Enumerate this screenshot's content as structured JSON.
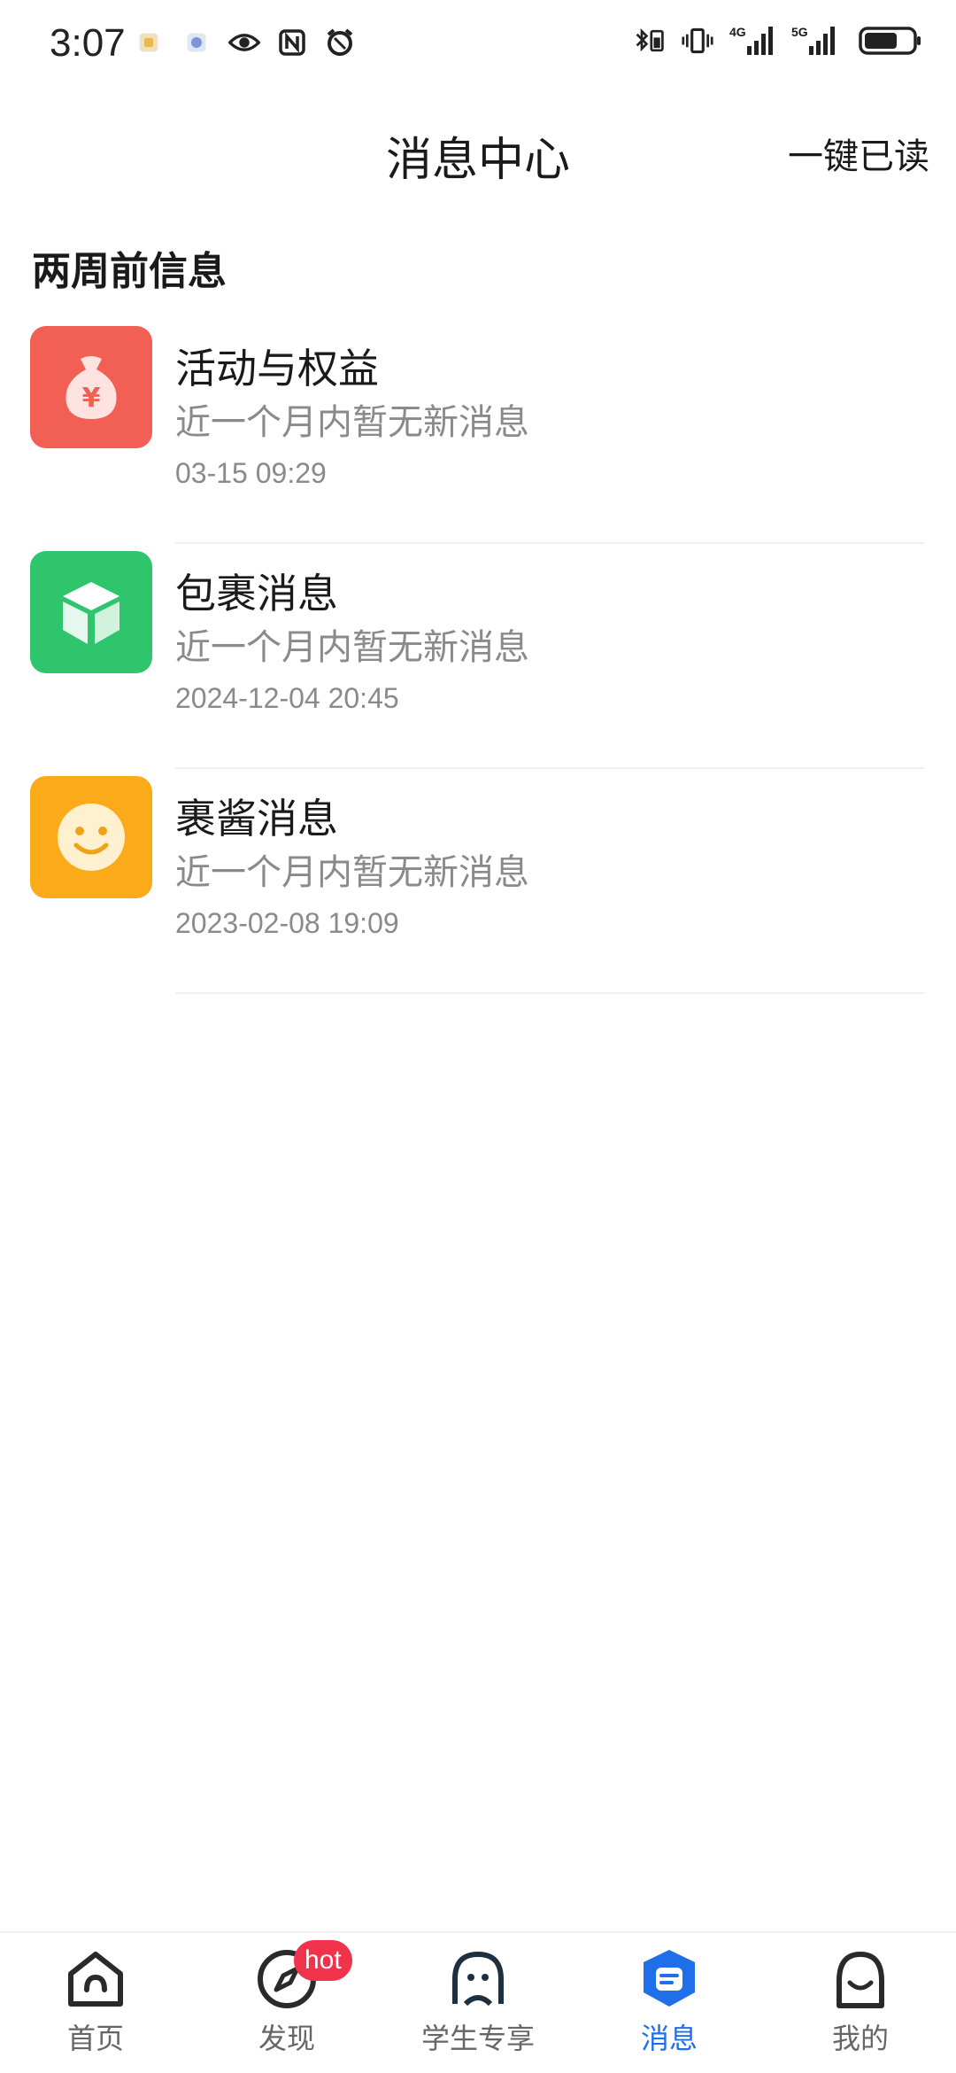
{
  "status_bar": {
    "time": "3:07",
    "left_icons": [
      "sim-card-icon",
      "app-notification-icon",
      "eye-icon",
      "nfc-icon",
      "alarm-icon"
    ],
    "right_icons": [
      "bluetooth-icon",
      "vibrate-icon",
      "signal-4g-icon",
      "signal-5g-icon",
      "battery-icon"
    ],
    "signal_4g_label": "4G",
    "signal_5g_label": "5G",
    "battery_level": 0.7
  },
  "header": {
    "title": "消息中心",
    "mark_all_read": "一键已读"
  },
  "section": {
    "title": "两周前信息"
  },
  "messages": [
    {
      "title": "活动与权益",
      "subtitle": "近一个月内暂无新消息",
      "time": "03-15 09:29",
      "icon": "money-bag-icon",
      "icon_color": "#f25f55",
      "icon_glyph": "¥"
    },
    {
      "title": "包裹消息",
      "subtitle": "近一个月内暂无新消息",
      "time": "2024-12-04 20:45",
      "icon": "package-box-icon",
      "icon_color": "#2ec56d"
    },
    {
      "title": "裹酱消息",
      "subtitle": "近一个月内暂无新消息",
      "time": "2023-02-08 19:09",
      "icon": "smiley-face-icon",
      "icon_color": "#fbab1a"
    }
  ],
  "bottom_nav": {
    "items": [
      {
        "label": "首页",
        "icon": "home-icon",
        "active": false
      },
      {
        "label": "发现",
        "icon": "compass-icon",
        "active": false,
        "badge": "hot"
      },
      {
        "label": "学生专享",
        "icon": "student-icon",
        "active": false
      },
      {
        "label": "消息",
        "icon": "message-icon",
        "active": true
      },
      {
        "label": "我的",
        "icon": "profile-icon",
        "active": false
      }
    ],
    "active_color": "#1f6fe8",
    "badge_color": "#f0334b"
  }
}
